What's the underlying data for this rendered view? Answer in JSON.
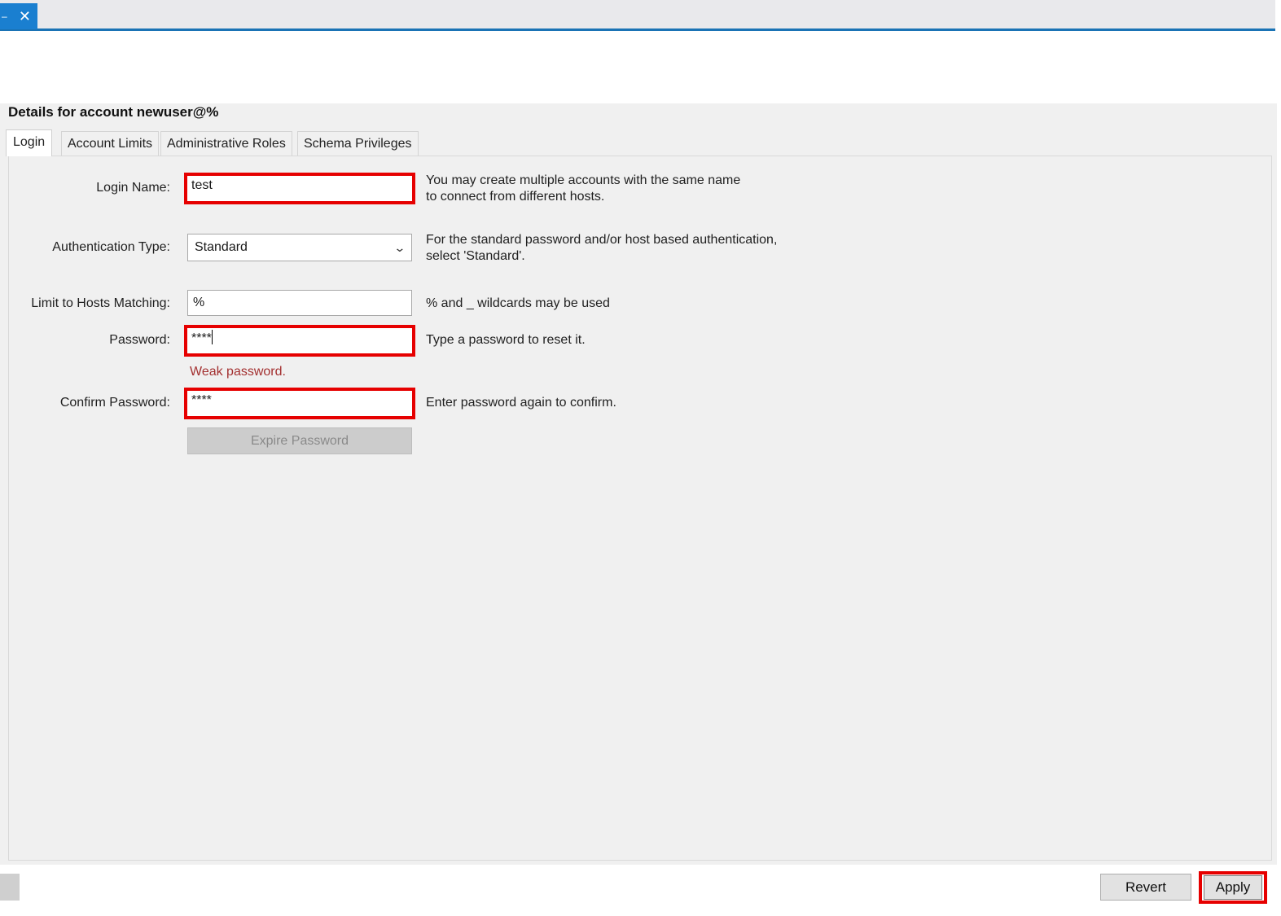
{
  "window": {
    "tab_minimize": "–",
    "tab_close": "✕"
  },
  "details_title": "Details for account newuser@%",
  "tabs": [
    {
      "label": "Login"
    },
    {
      "label": "Account Limits"
    },
    {
      "label": "Administrative Roles"
    },
    {
      "label": "Schema Privileges"
    }
  ],
  "form": {
    "login_name": {
      "label": "Login Name:",
      "value": "test",
      "hint_line1": "You may create multiple accounts with the same name",
      "hint_line2": "to connect from different hosts."
    },
    "auth_type": {
      "label": "Authentication Type:",
      "value": "Standard",
      "hint_line1": "For the standard password and/or host based authentication,",
      "hint_line2": "select 'Standard'."
    },
    "hosts": {
      "label": "Limit to Hosts Matching:",
      "value": "%",
      "hint": "% and _ wildcards may be used"
    },
    "password": {
      "label": "Password:",
      "value": "****",
      "hint": "Type a password to reset it.",
      "warning": "Weak password."
    },
    "confirm_password": {
      "label": "Confirm Password:",
      "value": "****",
      "hint": "Enter password again to confirm."
    },
    "expire_button": "Expire Password"
  },
  "footer": {
    "revert": "Revert",
    "apply": "Apply"
  },
  "colors": {
    "highlight": "#e60000",
    "accent": "#1a7fd0",
    "warning": "#a33030"
  }
}
